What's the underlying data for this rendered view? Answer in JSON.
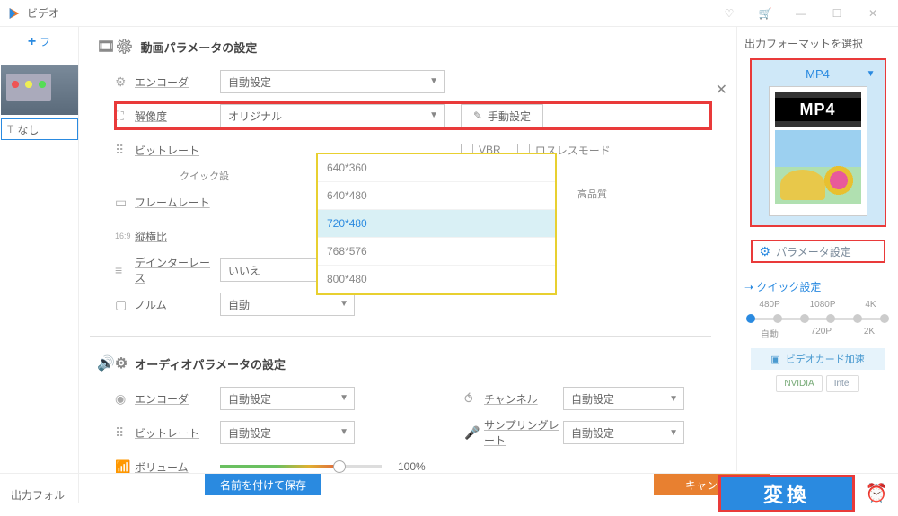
{
  "titlebar": {
    "title": "ビデオ"
  },
  "left": {
    "add": "フ",
    "clip_label": "なし"
  },
  "right": {
    "title": "出力フォーマットを選択",
    "format_name": "MP4",
    "format_badge": "MP4",
    "param_button": "パラメータ設定",
    "quick_title": "クイック設定",
    "scale_top": [
      "480P",
      "1080P",
      "4K"
    ],
    "scale_bottom": [
      "自動",
      "720P",
      "2K"
    ],
    "gpu_button": "ビデオカード加速",
    "badge_nvidia": "NVIDIA",
    "badge_intel": "Intel"
  },
  "bottom": {
    "output_folder": "出力フォル",
    "convert": "変換"
  },
  "modal": {
    "video_section": "動画パラメータの設定",
    "audio_section": "オーディオパラメータの設定",
    "labels": {
      "encoder": "エンコーダ",
      "resolution": "解像度",
      "bitrate": "ビットレート",
      "quick": "クイック設",
      "framerate": "フレームレート",
      "aspect": "縦横比",
      "deinterlace": "デインターレース",
      "norm": "ノルム",
      "channel": "チャンネル",
      "samplerate": "サンプリングレート",
      "volume": "ボリューム"
    },
    "values": {
      "encoder": "自動設定",
      "resolution": "オリジナル",
      "deinterlace": "いいえ",
      "norm": "自動",
      "audio_encoder": "自動設定",
      "audio_bitrate": "自動設定",
      "channel": "自動設定",
      "samplerate": "自動設定",
      "volume": "100%"
    },
    "side": {
      "manual": "手動設定",
      "vbr": "VBR",
      "lossless": "ロスレスモード",
      "high_quality": "高品質"
    },
    "dropdown": [
      "640*360",
      "640*480",
      "720*480",
      "768*576",
      "800*480"
    ],
    "dropdown_selected": "720*480",
    "footer": {
      "save": "名前を付けて保存",
      "cancel": "キャンセル"
    }
  }
}
